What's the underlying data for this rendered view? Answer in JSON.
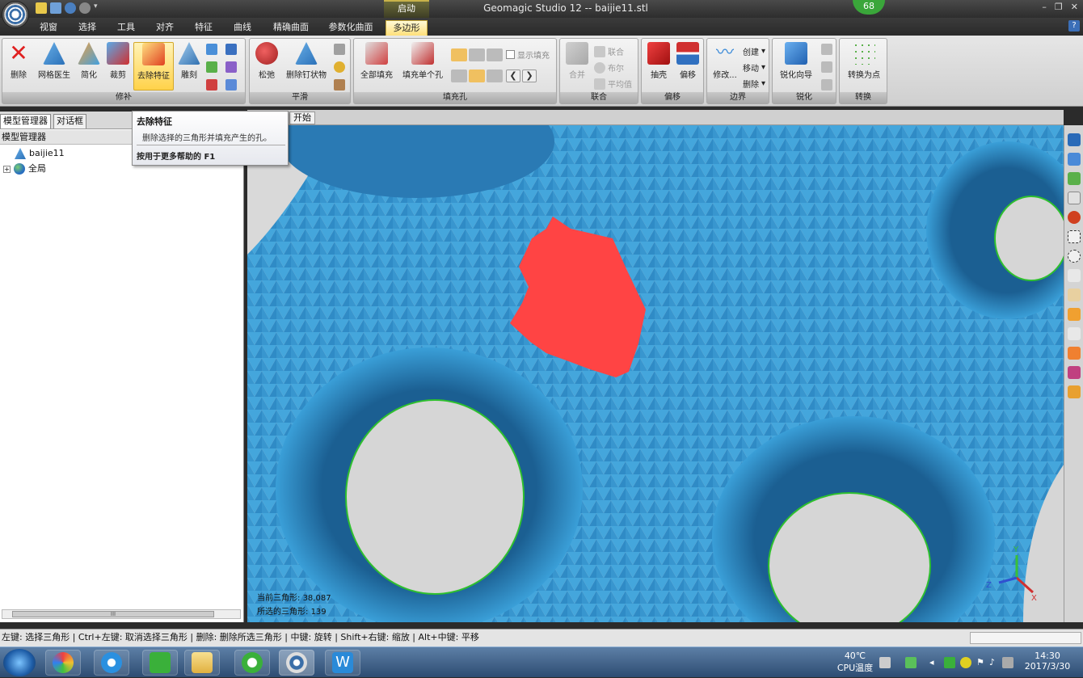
{
  "window": {
    "title": "Geomagic Studio 12 -- baijie11.stl",
    "context_tab_label": "启动",
    "notification_count": "68"
  },
  "tabs": [
    "视窗",
    "选择",
    "工具",
    "对齐",
    "特征",
    "曲线",
    "精确曲面",
    "参数化曲面",
    "多边形"
  ],
  "active_tab": "多边形",
  "ribbon": {
    "groups": {
      "repair": "修补",
      "smooth": "平滑",
      "fill": "填充孔",
      "union": "联合",
      "offset": "偏移",
      "boundary": "边界",
      "sharpen": "锐化",
      "convert": "转换"
    },
    "repair": {
      "delete": "删除",
      "mesh_doctor": "网格医生",
      "simplify": "简化",
      "trim": "裁剪",
      "remove_feature": "去除特征",
      "carve": "雕刻"
    },
    "smooth": {
      "relax": "松弛",
      "remove_spikes": "删除钉状物"
    },
    "fill": {
      "fill_all": "全部填充",
      "fill_single": "填充单个孔",
      "show_fill": "显示填充"
    },
    "union": {
      "merge": "合并",
      "combine": "联合",
      "boolean": "布尔",
      "average": "平均值"
    },
    "offset": {
      "shell": "抽壳",
      "offset": "偏移"
    },
    "boundary": {
      "modify": "修改...",
      "create": "创建",
      "move": "移动",
      "delete": "删除"
    },
    "sharpen": {
      "wizard": "锐化向导"
    },
    "convert": {
      "to_points": "转换为点"
    }
  },
  "left_panel": {
    "tabs": [
      "模型管理器",
      "对话框"
    ],
    "header": "模型管理器",
    "items": [
      "baijie11",
      "全局"
    ],
    "scroll_glyph": "III"
  },
  "viewport": {
    "tab": "开始",
    "stats": {
      "current_label": "当前三角形",
      "current_value": "38,087",
      "selected_label": "所选的三角形",
      "selected_value": "139"
    },
    "axis": {
      "x": "X",
      "y": "Y",
      "z": "Z"
    }
  },
  "tooltip": {
    "title": "去除特征",
    "body": "删除选择的三角形并填充产生的孔。",
    "help": "按用于更多帮助的 F1"
  },
  "status_bar": "左键: 选择三角形 | Ctrl+左键: 取消选择三角形 | 删除: 删除所选三角形 | 中键: 旋转 | Shift+右键: 缩放 | Alt+中键: 平移",
  "taskbar": {
    "temp": "40℃",
    "temp_label": "CPU温度",
    "time": "14:30",
    "date": "2017/3/30"
  },
  "colors": {
    "mesh": "#3a9fd8",
    "selection": "#ff4444",
    "accent": "#ffd24a"
  }
}
